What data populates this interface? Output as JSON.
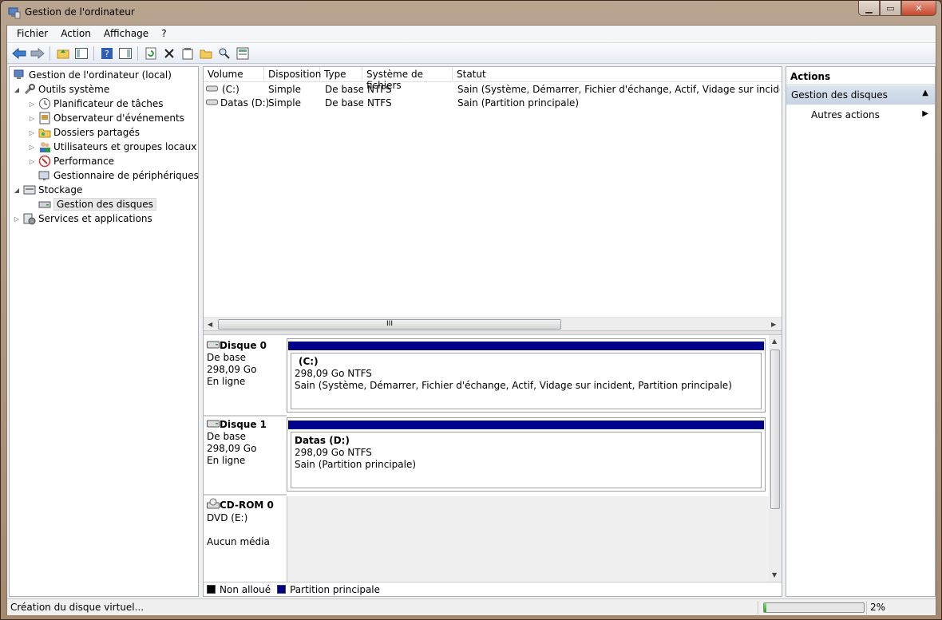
{
  "window": {
    "title": "Gestion de l'ordinateur",
    "caption_buttons": [
      "minimize-button",
      "maximize-button",
      "close-button"
    ]
  },
  "menu": [
    "Fichier",
    "Action",
    "Affichage",
    "?"
  ],
  "toolbar": [
    "back-icon",
    "forward-icon",
    "up-folder-icon",
    "show-hide-tree-icon",
    "help-icon",
    "show-hide-action-pane-icon",
    "refresh-icon",
    "delete-icon",
    "properties-icon",
    "open-icon",
    "search-icon",
    "export-icon"
  ],
  "tree": {
    "root": "Gestion de l'ordinateur (local)",
    "system_tools": "Outils système",
    "task_scheduler": "Planificateur de tâches",
    "event_viewer": "Observateur d'événements",
    "shared_folders": "Dossiers partagés",
    "local_users": "Utilisateurs et groupes locaux",
    "performance": "Performance",
    "device_manager": "Gestionnaire de périphériques",
    "storage": "Stockage",
    "disk_management": "Gestion des disques",
    "services": "Services et applications"
  },
  "volume_list": {
    "headers": [
      "Volume",
      "Disposition",
      "Type",
      "Système de fichiers",
      "Statut"
    ],
    "rows": [
      [
        "(C:)",
        "Simple",
        "De base",
        "NTFS",
        "Sain (Système, Démarrer, Fichier d'échange, Actif, Vidage sur incident, Partition principale)"
      ],
      [
        "Datas (D:)",
        "Simple",
        "De base",
        "NTFS",
        "Sain (Partition principale)"
      ]
    ],
    "scroll_grip": "III"
  },
  "disks": [
    {
      "name": "Disque 0",
      "type": "De base",
      "size": "298,09 Go",
      "state": "En ligne",
      "volume_name": "(C:)",
      "volume_size": "298,09 Go NTFS",
      "volume_status": "Sain (Système, Démarrer, Fichier d'échange, Actif, Vidage sur incident, Partition principale)"
    },
    {
      "name": "Disque 1",
      "type": "De base",
      "size": "298,09 Go",
      "state": "En ligne",
      "volume_name": "Datas  (D:)",
      "volume_size": "298,09 Go NTFS",
      "volume_status": "Sain (Partition principale)"
    }
  ],
  "cdrom": {
    "name": "CD-ROM 0",
    "drive": "DVD (E:)",
    "media": "Aucun média"
  },
  "legend": [
    {
      "label": "Non alloué",
      "color": "#000000"
    },
    {
      "label": "Partition principale",
      "color": "#00008b"
    }
  ],
  "actions": {
    "title": "Actions",
    "section": "Gestion des disques",
    "more": "Autres actions"
  },
  "status": {
    "text": "Création du disque virtuel...",
    "progress_percent": 2,
    "progress_label": "2%"
  },
  "colors": {
    "primary_partition": "#00008b",
    "unallocated": "#000000",
    "progress": "#1fa71b"
  }
}
